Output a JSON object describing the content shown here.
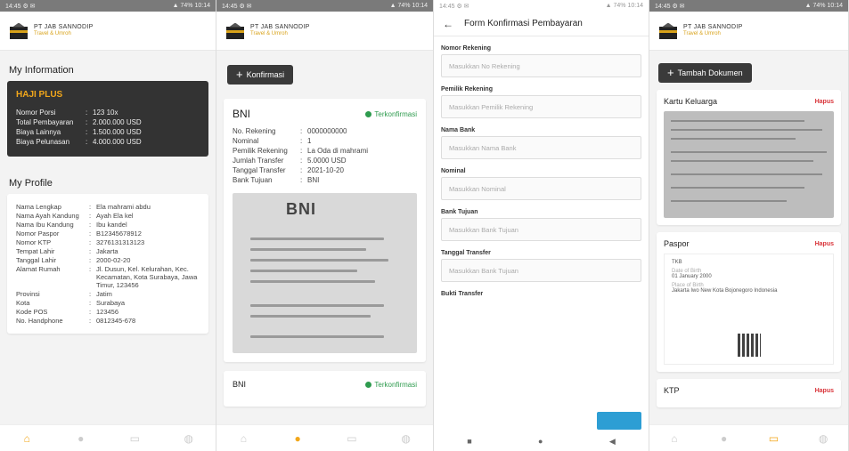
{
  "status_left": "14:45 ⚙ ✉",
  "status_right": "▲ 74% 10:14",
  "brand": {
    "name": "PT JAB SANNODIP",
    "tagline": "Travel & Umroh"
  },
  "screen1": {
    "section_my_info": "My Information",
    "package_badge": "HAJI PLUS",
    "info": [
      {
        "k": "Nomor Porsi",
        "v": "123 10x"
      },
      {
        "k": "Total Pembayaran",
        "v": "2.000.000 USD"
      },
      {
        "k": "Biaya Lainnya",
        "v": "1.500.000 USD"
      },
      {
        "k": "Biaya Pelunasan",
        "v": "4.000.000 USD"
      }
    ],
    "section_profile": "My Profile",
    "profile": [
      {
        "k": "Nama Lengkap",
        "v": "Ela mahrami abdu"
      },
      {
        "k": "Nama Ayah Kandung",
        "v": "Ayah Ela kel"
      },
      {
        "k": "Nama Ibu Kandung",
        "v": "Ibu kandel"
      },
      {
        "k": "Nomor Paspor",
        "v": "B12345678912"
      },
      {
        "k": "Nomor KTP",
        "v": "3276131313123"
      },
      {
        "k": "Tempat Lahir",
        "v": "Jakarta"
      },
      {
        "k": "Tanggal Lahir",
        "v": "2000-02-20"
      },
      {
        "k": "Alamat Rumah",
        "v": "Jl. Dusun, Kel. Kelurahan, Kec. Kecamatan, Kota Surabaya, Jawa Timur, 123456"
      },
      {
        "k": "Provinsi",
        "v": "Jatim"
      },
      {
        "k": "Kota",
        "v": "Surabaya"
      },
      {
        "k": "Kode POS",
        "v": "123456"
      },
      {
        "k": "No. Handphone",
        "v": "0812345-678"
      }
    ]
  },
  "screen2": {
    "confirm_button": "Konfirmasi",
    "payment": {
      "bank": "BNI",
      "status": "Terkonfirmasi",
      "rows": [
        {
          "k": "No. Rekening",
          "v": "0000000000"
        },
        {
          "k": "Nominal",
          "v": "1"
        },
        {
          "k": "Pemilik Rekening",
          "v": "La Oda di mahrami"
        },
        {
          "k": "Jumlah Transfer",
          "v": "5.0000 USD"
        },
        {
          "k": "Tanggal Transfer",
          "v": "2021-10-20"
        },
        {
          "k": "Bank Tujuan",
          "v": "BNI"
        }
      ],
      "receipt_logo": "BNI"
    },
    "next_bank": "BNI",
    "next_status": "Terkonfirmasi"
  },
  "screen3": {
    "title": "Form Konfirmasi Pembayaran",
    "fields": [
      {
        "label": "Nomor Rekening",
        "placeholder": "Masukkan No Rekening"
      },
      {
        "label": "Pemilik Rekening",
        "placeholder": "Masukkan Pemilik Rekening"
      },
      {
        "label": "Nama Bank",
        "placeholder": "Masukkan Nama Bank"
      },
      {
        "label": "Nominal",
        "placeholder": "Masukkan Nominal"
      },
      {
        "label": "Bank Tujuan",
        "placeholder": "Masukkan Bank Tujuan"
      },
      {
        "label": "Tanggal Transfer",
        "placeholder": "Masukkan Bank Tujuan"
      },
      {
        "label": "Bukti Transfer",
        "placeholder": ""
      }
    ]
  },
  "screen4": {
    "add_button": "Tambah Dokumen",
    "docs": [
      {
        "title": "Kartu Keluarga",
        "action": "Hapus"
      },
      {
        "title": "Paspor",
        "action": "Hapus"
      },
      {
        "title": "KTP",
        "action": "Hapus"
      }
    ],
    "passport_lines": [
      "TKB",
      "Date of Birth",
      "01 January 2000",
      "Place of Birth",
      "Jakarta Iwo New Kota Bojonegoro Indonesia"
    ]
  },
  "colors": {
    "accent": "#f2a71b",
    "dark_card": "#333333",
    "success": "#2e9b4e",
    "danger": "#d9343a",
    "upload": "#2d9ed4"
  }
}
